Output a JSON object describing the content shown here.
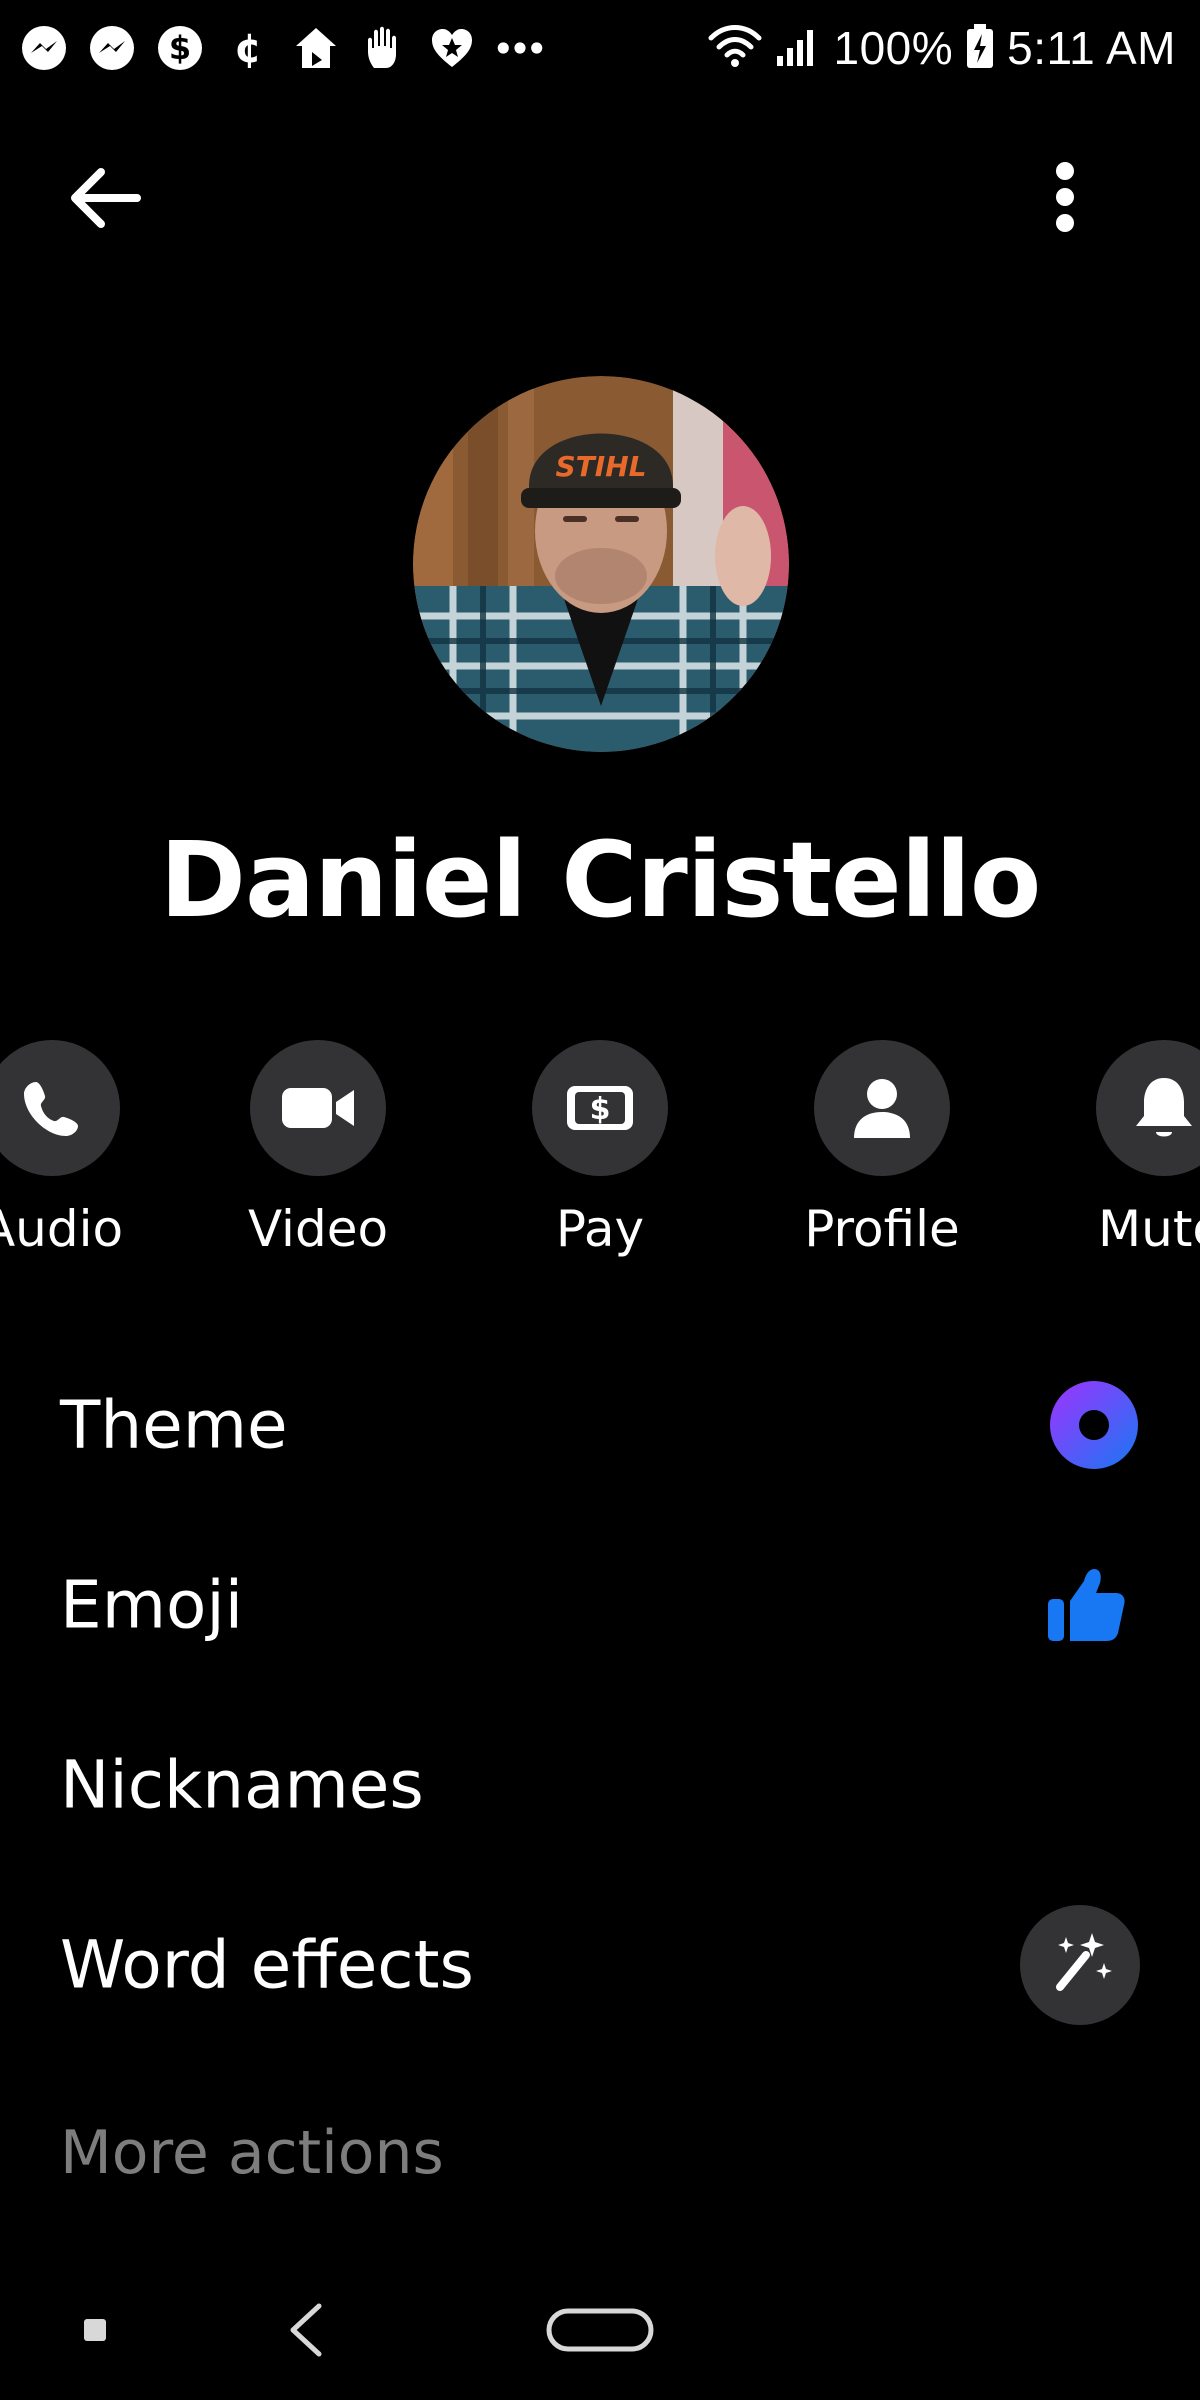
{
  "status_bar": {
    "left_icons": [
      "messenger-icon",
      "messenger-icon",
      "dollar-icon",
      "cent-icon",
      "home-icon",
      "hand-icon",
      "heart-icon",
      "more-dots-icon"
    ],
    "battery_percent": "100%",
    "time": "5:11 AM"
  },
  "header": {
    "back_icon": "arrow-left-icon",
    "more_icon": "vertical-dots-icon"
  },
  "profile": {
    "name": "Daniel Cristello",
    "cap_text": "STIHL"
  },
  "actions": [
    {
      "id": "audio",
      "label": "Audio",
      "icon": "phone-icon"
    },
    {
      "id": "video",
      "label": "Video",
      "icon": "video-camera-icon"
    },
    {
      "id": "pay",
      "label": "Pay",
      "icon": "pay-icon"
    },
    {
      "id": "profile",
      "label": "Profile",
      "icon": "person-icon"
    },
    {
      "id": "mute",
      "label": "Mute",
      "icon": "bell-icon"
    }
  ],
  "settings": [
    {
      "id": "theme",
      "label": "Theme",
      "icon": "theme-icon"
    },
    {
      "id": "emoji",
      "label": "Emoji",
      "icon": "thumbs-up-icon"
    },
    {
      "id": "nicknames",
      "label": "Nicknames",
      "icon": ""
    },
    {
      "id": "word_effects",
      "label": "Word effects",
      "icon": "magic-wand-icon"
    }
  ],
  "more_actions_header": "More actions",
  "colors": {
    "background": "#000000",
    "action_circle": "#333335",
    "muted_text": "#7d7d7d",
    "messenger_blue": "#1877f2",
    "theme_purple": "#a033ff"
  },
  "nav": [
    "recents-icon",
    "back-icon",
    "home-icon"
  ]
}
